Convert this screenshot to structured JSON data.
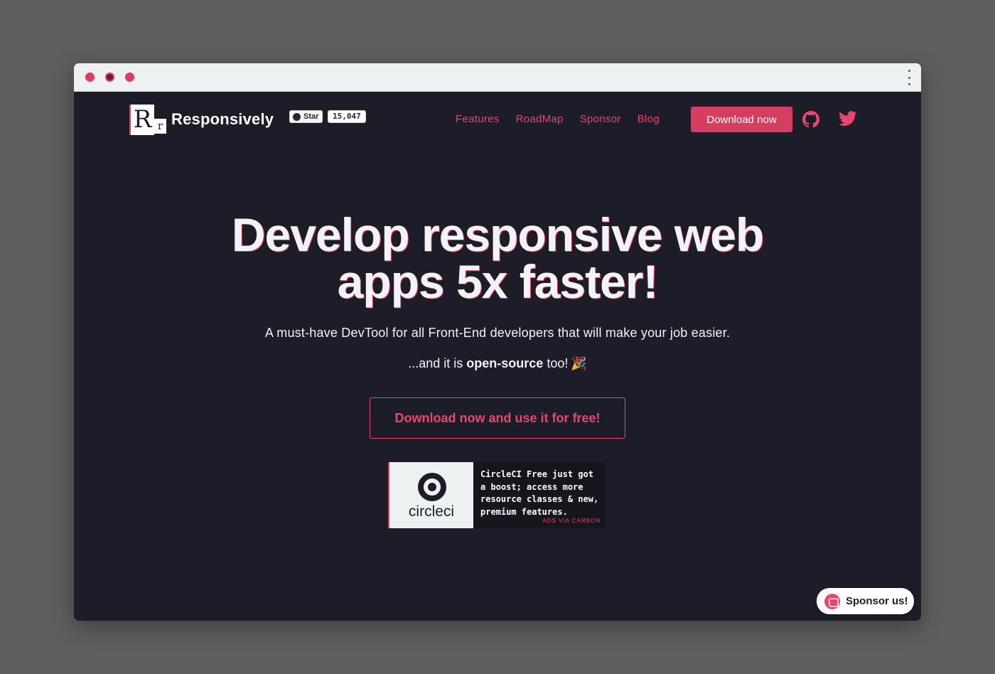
{
  "window": {
    "controls": [
      "close",
      "minimize",
      "maximize"
    ]
  },
  "header": {
    "logo_big": "R",
    "logo_small": "r",
    "brand": "Responsively",
    "github_star_label": "Star",
    "github_star_count": "15,047",
    "nav": [
      {
        "label": "Features"
      },
      {
        "label": "RoadMap"
      },
      {
        "label": "Sponsor"
      },
      {
        "label": "Blog"
      }
    ],
    "download_label": "Download now",
    "social_icons": [
      "github-icon",
      "twitter-icon"
    ]
  },
  "hero": {
    "title_line1": "Develop responsive web",
    "title_line2": "apps 5x faster!",
    "subtitle": "A must-have DevTool for all Front-End developers that will make your job easier.",
    "open_source_prefix": "...and it is ",
    "open_source_bold": "open-source",
    "open_source_suffix": " too!",
    "party_icon": "🎉",
    "cta_label": "Download now and use it for free!"
  },
  "ad": {
    "brand_text": "circleci",
    "text": "CircleCI Free just got a boost; access more resource classes & new, premium features.",
    "via": "ADS VIA CARBON"
  },
  "sponsor_button": {
    "label": "Sponsor us!"
  },
  "colors": {
    "accent": "#de3e62",
    "background": "#1d1c29",
    "titlebar": "#eef1f1",
    "outer": "#5e5e5c"
  }
}
